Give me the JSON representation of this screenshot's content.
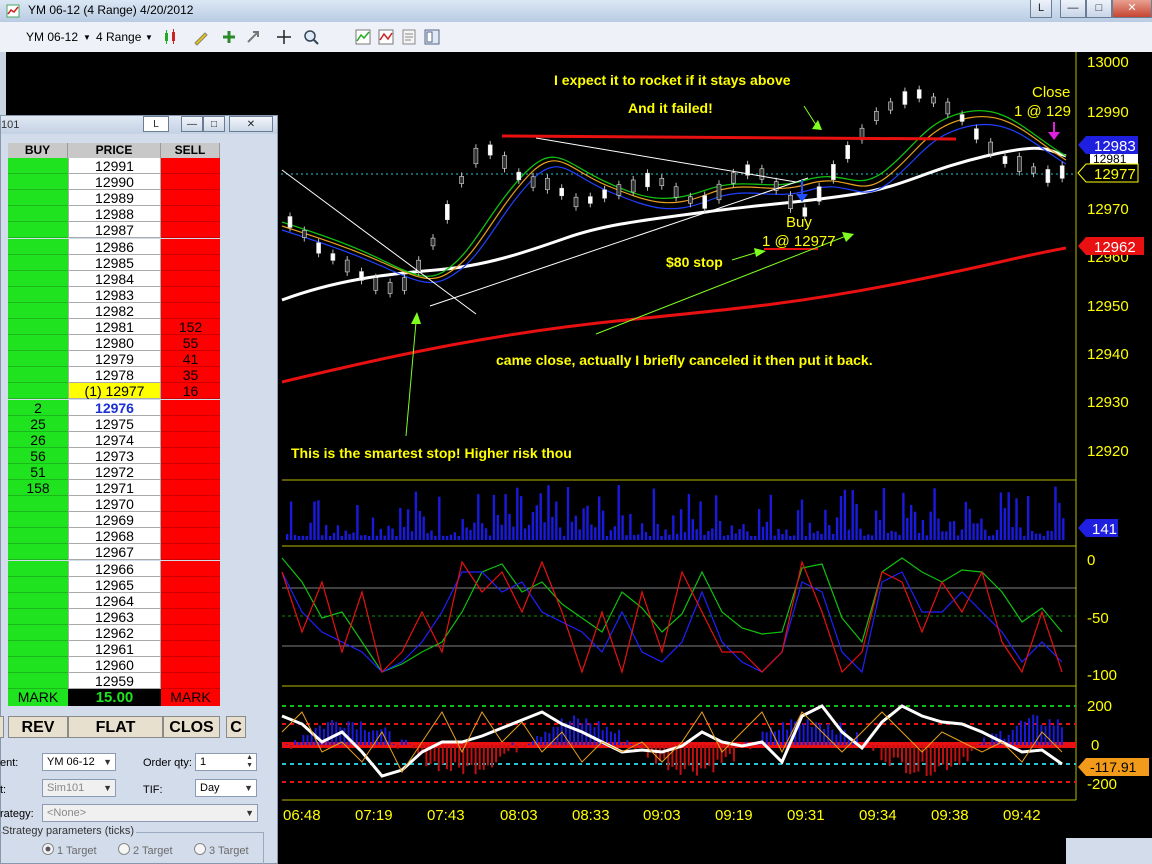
{
  "window": {
    "title": "YM 06-12 (4 Range)  4/20/2012",
    "buttons": [
      "L",
      "—",
      "□",
      "✕"
    ]
  },
  "toolbar": {
    "instrument": "YM 06-12",
    "period": "4 Range",
    "icons": [
      "candlestick-icon",
      "pencil-icon",
      "plus-icon",
      "crosshair-icon",
      "zoom-icon",
      "indicator-icon",
      "strategy-icon",
      "properties-icon",
      "data-box-icon"
    ]
  },
  "chart": {
    "price_axis": [
      "13000",
      "12990",
      "12970",
      "12960",
      "12950",
      "12940",
      "12930",
      "12920"
    ],
    "price_boxes": {
      "high": "12983",
      "current": "12977",
      "ma": "12962",
      "obscured": "12981",
      "volume": "141",
      "cci": "-117.91"
    },
    "time_axis": [
      "06:48",
      "07:19",
      "07:43",
      "08:03",
      "08:33",
      "09:03",
      "09:19",
      "09:31",
      "09:34",
      "09:38",
      "09:42"
    ],
    "stoch_axis": [
      "0",
      "-50",
      "-100"
    ],
    "cci_axis": [
      "200",
      "0",
      "-200"
    ],
    "annotations": {
      "rocket": "I expect it to rocket if it stays above",
      "failed": "And it failed!",
      "stop80": "$80 stop",
      "close_call": "came close, actually I briefly canceled it then put it back.",
      "smartest": "This is the smartest stop! Higher risk thou"
    },
    "trade_marks": {
      "buy_label": "Buy",
      "buy_detail": "1 @ 12977",
      "close_label": "Close",
      "close_detail": "1 @ 129"
    },
    "colors": {
      "up": "#ffffff",
      "down": "#ffffff",
      "sma_long": "#e81010",
      "sma_mid": "#ffffff",
      "resistance": "#e81010",
      "annotation": "#ffff00",
      "volume": "#1a1adf"
    }
  },
  "dom": {
    "title": "101",
    "title_buttons": [
      "L",
      "—",
      "□",
      "✕"
    ],
    "headers": [
      "BUY",
      "PRICE",
      "SELL"
    ],
    "rows": [
      {
        "buy": "",
        "price": "12991",
        "sell": ""
      },
      {
        "buy": "",
        "price": "12990",
        "sell": ""
      },
      {
        "buy": "",
        "price": "12989",
        "sell": ""
      },
      {
        "buy": "",
        "price": "12988",
        "sell": ""
      },
      {
        "buy": "",
        "price": "12987",
        "sell": ""
      },
      {
        "buy": "",
        "price": "12986",
        "sell": ""
      },
      {
        "buy": "",
        "price": "12985",
        "sell": ""
      },
      {
        "buy": "",
        "price": "12984",
        "sell": ""
      },
      {
        "buy": "",
        "price": "12983",
        "sell": ""
      },
      {
        "buy": "",
        "price": "12982",
        "sell": ""
      },
      {
        "buy": "",
        "price": "12981",
        "sell": "152"
      },
      {
        "buy": "",
        "price": "12980",
        "sell": "55"
      },
      {
        "buy": "",
        "price": "12979",
        "sell": "41"
      },
      {
        "buy": "",
        "price": "12978",
        "sell": "35"
      },
      {
        "buy": "",
        "price": "(1) 12977",
        "sell": "16",
        "highlight": "yellow"
      },
      {
        "buy": "2",
        "price": "12976",
        "sell": "",
        "highlight": "blue"
      },
      {
        "buy": "25",
        "price": "12975",
        "sell": ""
      },
      {
        "buy": "26",
        "price": "12974",
        "sell": ""
      },
      {
        "buy": "56",
        "price": "12973",
        "sell": ""
      },
      {
        "buy": "51",
        "price": "12972",
        "sell": ""
      },
      {
        "buy": "158",
        "price": "12971",
        "sell": ""
      },
      {
        "buy": "",
        "price": "12970",
        "sell": ""
      },
      {
        "buy": "",
        "price": "12969",
        "sell": ""
      },
      {
        "buy": "",
        "price": "12968",
        "sell": ""
      },
      {
        "buy": "",
        "price": "12967",
        "sell": ""
      },
      {
        "buy": "",
        "price": "12966",
        "sell": ""
      },
      {
        "buy": "",
        "price": "12965",
        "sell": ""
      },
      {
        "buy": "",
        "price": "12964",
        "sell": ""
      },
      {
        "buy": "",
        "price": "12963",
        "sell": ""
      },
      {
        "buy": "",
        "price": "12962",
        "sell": ""
      },
      {
        "buy": "",
        "price": "12961",
        "sell": ""
      },
      {
        "buy": "",
        "price": "12960",
        "sell": ""
      },
      {
        "buy": "",
        "price": "12959",
        "sell": ""
      }
    ],
    "footer": {
      "buy_mark": "MARK",
      "pnl": "15.00",
      "sell_mark": "MARK"
    },
    "actions": {
      "rev": "REV",
      "flat": "FLAT",
      "close": "CLOS",
      "c": "C"
    },
    "form": {
      "instrument_label": "ent:",
      "instrument": "YM 06-12",
      "account_label": "t:",
      "account": "Sim101",
      "order_qty_label": "Order qty:",
      "order_qty": "1",
      "tif_label": "TIF:",
      "tif": "Day",
      "strategy_label": "rategy:",
      "strategy": "<None>",
      "params_label": "Strategy parameters (ticks)",
      "targets": [
        "1 Target",
        "2 Target",
        "3 Target"
      ]
    }
  }
}
